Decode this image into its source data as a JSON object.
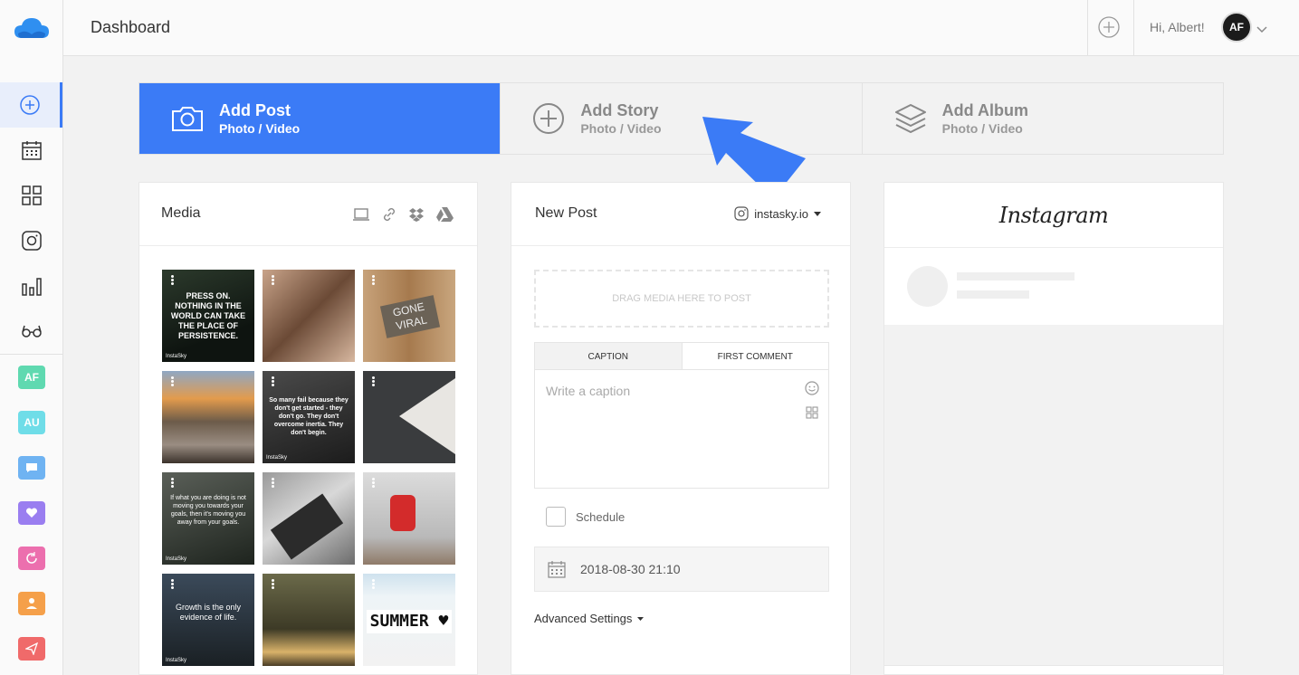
{
  "header": {
    "title": "Dashboard",
    "greeting": "Hi, Albert!",
    "avatar_initials": "AF"
  },
  "sidebar": {
    "nav_icons": [
      "plus-circle-icon",
      "calendar-icon",
      "grid-icon",
      "instagram-icon",
      "bar-chart-icon",
      "glasses-icon"
    ],
    "accounts": [
      {
        "label": "AF",
        "color": "#5fd9b0"
      },
      {
        "label": "AU",
        "color": "#6fdde8"
      },
      {
        "label": "",
        "icon": "chat-icon",
        "color": "#6fb3f2"
      },
      {
        "label": "",
        "icon": "heart-icon",
        "color": "#9a7ef0"
      },
      {
        "label": "",
        "icon": "refresh-icon",
        "color": "#ec6fae"
      },
      {
        "label": "",
        "icon": "person-icon",
        "color": "#f5a04a"
      },
      {
        "label": "",
        "icon": "send-icon",
        "color": "#f06a6a"
      }
    ]
  },
  "post_types": [
    {
      "title": "Add Post",
      "subtitle": "Photo / Video",
      "icon": "camera-icon",
      "active": true
    },
    {
      "title": "Add Story",
      "subtitle": "Photo / Video",
      "icon": "plus-circle-icon",
      "active": false
    },
    {
      "title": "Add Album",
      "subtitle": "Photo / Video",
      "icon": "layers-icon",
      "active": false
    }
  ],
  "media": {
    "title": "Media",
    "tools": [
      "laptop-icon",
      "link-icon",
      "dropbox-icon",
      "google-drive-icon"
    ],
    "thumbnails": [
      {
        "text": "PRESS ON. NOTHING IN THE WORLD CAN TAKE THE PLACE OF PERSISTENCE.",
        "brand": "InstaSky"
      },
      {
        "text": ""
      },
      {
        "text": "GONE VIRAL"
      },
      {
        "text": ""
      },
      {
        "text": "So many fail because they don't get started - they don't go. They don't overcome inertia. They don't begin.",
        "brand": "InstaSky"
      },
      {
        "text": ""
      },
      {
        "text": "If what you are doing is not moving you towards your goals, then it's moving you away from your goals.",
        "brand": "InstaSky"
      },
      {
        "text": ""
      },
      {
        "text": ""
      },
      {
        "text": "Growth is the only evidence of life.",
        "brand": "InstaSky"
      },
      {
        "text": ""
      },
      {
        "text": "SUMMER ♥"
      }
    ]
  },
  "new_post": {
    "title": "New Post",
    "account": "instasky.io",
    "dropzone": "DRAG MEDIA HERE TO POST",
    "tabs": [
      "CAPTION",
      "FIRST COMMENT"
    ],
    "caption_placeholder": "Write a caption",
    "schedule_label": "Schedule",
    "schedule_checked": false,
    "date": "2018-08-30 21:10",
    "advanced_settings": "Advanced Settings"
  },
  "preview": {
    "platform": "Instagram"
  },
  "colors": {
    "accent": "#3b7bf6",
    "arrow": "#3b7bf6"
  }
}
